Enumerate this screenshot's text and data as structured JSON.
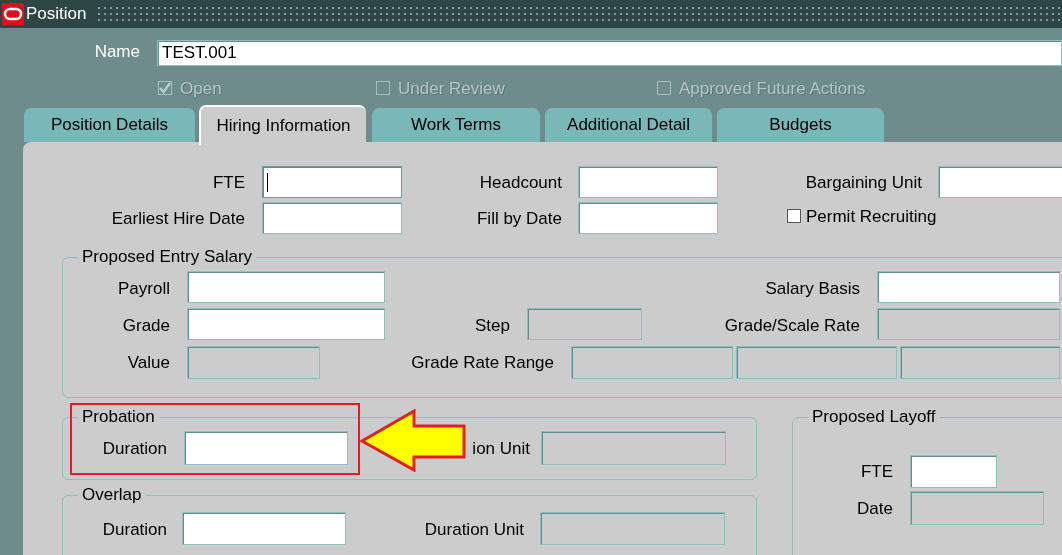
{
  "window": {
    "title": "Position"
  },
  "name_field": {
    "label": "Name",
    "value": "TEST.001"
  },
  "checkboxes": [
    {
      "label": "Open",
      "checked": true,
      "disabled": true
    },
    {
      "label": "Under Review",
      "checked": false,
      "disabled": true
    },
    {
      "label": "Approved Future Actions",
      "checked": false,
      "disabled": true
    }
  ],
  "tabs": [
    {
      "label": "Position Details",
      "selected": false
    },
    {
      "label": "Hiring Information",
      "selected": true
    },
    {
      "label": "Work Terms",
      "selected": false
    },
    {
      "label": "Additional Detail",
      "selected": false
    },
    {
      "label": "Budgets",
      "selected": false
    }
  ],
  "hiring_information": {
    "fields": [
      {
        "label": "FTE",
        "enabled": true,
        "focused": true
      },
      {
        "label": "Headcount",
        "enabled": true,
        "focused": false
      },
      {
        "label": "Bargaining Unit",
        "enabled": true,
        "focused": false
      },
      {
        "label": "Earliest Hire Date",
        "enabled": true,
        "focused": false
      },
      {
        "label": "Fill by Date",
        "enabled": true,
        "focused": false
      }
    ],
    "permit_recruiting": {
      "label": "Permit Recruiting",
      "checked": false
    },
    "sections": [
      {
        "title": "Proposed Entry Salary",
        "fields": [
          {
            "label": "Payroll",
            "enabled": true
          },
          {
            "label": "Salary Basis",
            "enabled": true
          },
          {
            "label": "Grade",
            "enabled": true
          },
          {
            "label": "Step",
            "enabled": false
          },
          {
            "label": "Grade/Scale Rate",
            "enabled": false
          },
          {
            "label": "Value",
            "enabled": false
          },
          {
            "label": "Grade Rate Range",
            "enabled": false
          }
        ]
      },
      {
        "title": "Probation",
        "fields": [
          {
            "label": "Duration",
            "enabled": true
          },
          {
            "label": "ion Unit",
            "enabled": false
          }
        ]
      },
      {
        "title": "Overlap",
        "fields": [
          {
            "label": "Duration",
            "enabled": true
          },
          {
            "label": "Duration Unit",
            "enabled": false
          }
        ]
      },
      {
        "title": "Proposed Layoff",
        "fields": [
          {
            "label": "FTE",
            "enabled": true
          },
          {
            "label": "Date",
            "enabled": false
          }
        ]
      }
    ]
  }
}
